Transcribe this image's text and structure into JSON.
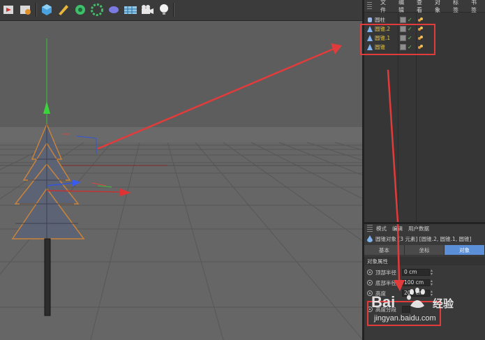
{
  "toolbar": {
    "icons": [
      "play-object-icon",
      "render-settings-icon",
      "cube-icon",
      "pen-icon",
      "gear-subdivision-icon",
      "flower-array-icon",
      "sphere-deformer-icon",
      "floor-grid-icon",
      "camera-icon",
      "light-bulb-icon"
    ]
  },
  "viewport": {
    "nav_icons": "✥⬇⊘⬜"
  },
  "object_manager": {
    "menu": [
      "文件",
      "编辑",
      "查看",
      "对象",
      "标签",
      "书签"
    ],
    "objects": [
      {
        "name": "圆柱",
        "type": "cylinder",
        "highlighted": false
      },
      {
        "name": "圆锥.2",
        "type": "cone",
        "highlighted": true
      },
      {
        "name": "圆锥.1",
        "type": "cone",
        "highlighted": true
      },
      {
        "name": "圆锥",
        "type": "cone",
        "highlighted": true
      }
    ]
  },
  "attribute_manager": {
    "menu": [
      "模式",
      "编辑",
      "用户数据"
    ],
    "title": "圆锥对象 [3 元素] [圆锥.2, 圆锥.1, 圆锥]",
    "tabs": [
      {
        "label": "基本",
        "active": false
      },
      {
        "label": "坐标",
        "active": false
      },
      {
        "label": "对象",
        "active": true
      }
    ],
    "section": "对象属性",
    "fields": [
      {
        "label": "顶部半径",
        "value": "0 cm"
      },
      {
        "label": "底部半径",
        "value": "100 cm"
      },
      {
        "label": "高度",
        "value": "200 cm"
      },
      {
        "label": "高度分段",
        "value": ""
      }
    ]
  },
  "watermark": {
    "brand": "Bai",
    "brand_suffix": "经验",
    "url": "jingyan.baidu.com"
  },
  "colors": {
    "annotation_red": "#e23b3b",
    "selected_yellow": "#e0c24a",
    "active_tab": "#5b8fd8"
  }
}
